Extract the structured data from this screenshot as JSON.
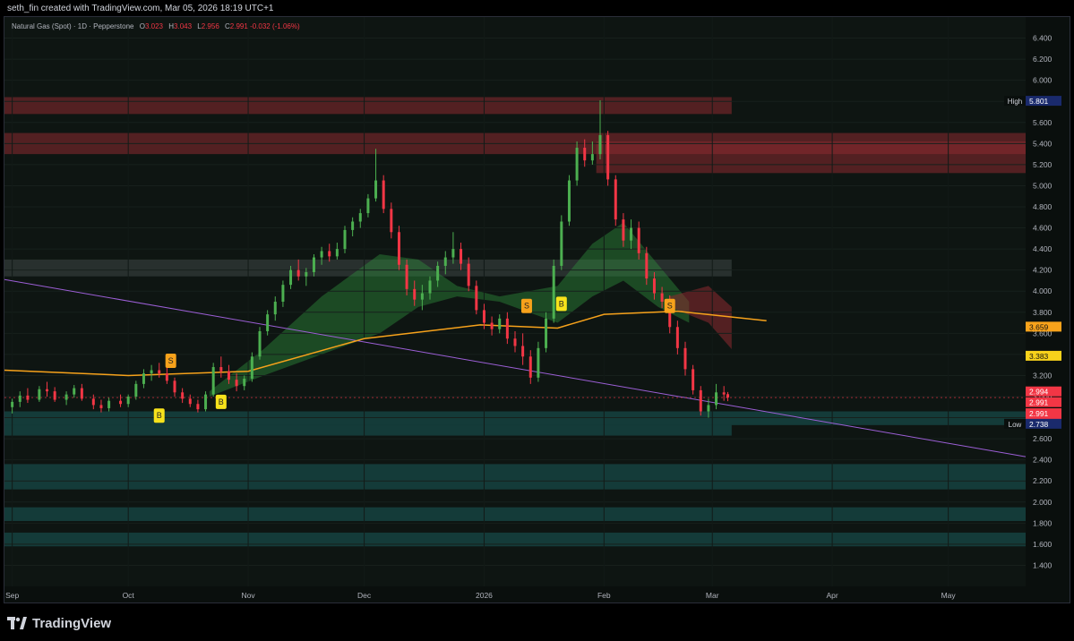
{
  "header": {
    "created_by": "seth_fin created with TradingView.com, Mar 05, 2026 18:19 UTC+1"
  },
  "brand": {
    "name": "TradingView"
  },
  "legend": {
    "symbol": "Natural Gas (Spot) · 1D · Pepperstone",
    "open_label": "O",
    "open": "3.023",
    "high_label": "H",
    "high": "3.043",
    "low_label": "L",
    "low": "2.956",
    "close_label": "C",
    "close": "2.991",
    "change": "-0.032 (-1.06%)"
  },
  "chart_data": {
    "type": "candlestick",
    "title": "Natural Gas (Spot) · 1D · Pepperstone",
    "ylim": [
      1.2,
      6.6
    ],
    "y_ticks": [
      "6.400",
      "6.200",
      "6.000",
      "5.800",
      "5.600",
      "5.400",
      "5.200",
      "5.000",
      "4.800",
      "4.600",
      "4.400",
      "4.200",
      "4.000",
      "3.800",
      "3.600",
      "3.400",
      "3.200",
      "3.000",
      "2.800",
      "2.600",
      "2.400",
      "2.200",
      "2.000",
      "1.800",
      "1.600",
      "1.400"
    ],
    "x_ticks": [
      {
        "label": "Sep",
        "date": "2025-09-01"
      },
      {
        "label": "Oct",
        "date": "2025-10-01"
      },
      {
        "label": "Nov",
        "date": "2025-11-01"
      },
      {
        "label": "Dec",
        "date": "2025-12-01"
      },
      {
        "label": "2026",
        "date": "2026-01-01"
      },
      {
        "label": "Feb",
        "date": "2026-02-01"
      },
      {
        "label": "Mar",
        "date": "2026-03-01"
      },
      {
        "label": "Apr",
        "date": "2026-04-01"
      },
      {
        "label": "May",
        "date": "2026-05-01"
      }
    ],
    "x_range": [
      "2025-08-30",
      "2026-05-21"
    ],
    "colors": {
      "up": "#4caf50",
      "down": "#f23645",
      "ma": "#f7a21b",
      "trendline": "#9c5fd6",
      "cloud": "#1e6b36",
      "supply": "#8c2a2f",
      "demand": "#1c6b6a"
    },
    "price_labels": [
      {
        "name": "High",
        "value": "5.801",
        "bg": "#1a2a6c"
      },
      {
        "name": "",
        "value": "3.659",
        "bg": "#f7a21b"
      },
      {
        "name": "",
        "value": "3.383",
        "bg": "#f7d21b"
      },
      {
        "name": "",
        "value": "2.994",
        "bg": "#f23645"
      },
      {
        "name": "",
        "value": "2.991",
        "bg": "#f23645"
      },
      {
        "name": "",
        "value": "2.991",
        "countdown": "04:39:30",
        "bg": "#f23645"
      },
      {
        "name": "Low",
        "value": "2.738",
        "bg": "#1a2a6c"
      }
    ],
    "moving_average": [
      {
        "date": "2025-08-30",
        "value": 3.25
      },
      {
        "date": "2025-10-01",
        "value": 3.2
      },
      {
        "date": "2025-11-01",
        "value": 3.24
      },
      {
        "date": "2025-12-01",
        "value": 3.55
      },
      {
        "date": "2025-12-31",
        "value": 3.68
      },
      {
        "date": "2026-01-20",
        "value": 3.65
      },
      {
        "date": "2026-02-01",
        "value": 3.78
      },
      {
        "date": "2026-02-20",
        "value": 3.81
      },
      {
        "date": "2026-03-15",
        "value": 3.72
      }
    ],
    "trendline": [
      {
        "date": "2025-08-30",
        "value": 4.11
      },
      {
        "date": "2026-05-21",
        "value": 2.43
      }
    ],
    "zones": [
      {
        "kind": "supply",
        "from": "2025-08-30",
        "to": "2026-03-06",
        "low": 5.68,
        "high": 5.84
      },
      {
        "kind": "supply",
        "from": "2025-08-30",
        "to": "2026-05-21",
        "low": 5.3,
        "high": 5.5
      },
      {
        "kind": "supply",
        "from": "2026-01-30",
        "to": "2026-05-21",
        "low": 5.12,
        "high": 5.42
      },
      {
        "kind": "neutral",
        "from": "2025-08-30",
        "to": "2026-03-06",
        "low": 4.14,
        "high": 4.3
      },
      {
        "kind": "demand",
        "from": "2025-08-30",
        "to": "2026-05-21",
        "low": 2.73,
        "high": 2.86
      },
      {
        "kind": "demand",
        "from": "2025-08-30",
        "to": "2026-03-06",
        "low": 2.63,
        "high": 2.73
      },
      {
        "kind": "demand",
        "from": "2025-08-30",
        "to": "2026-05-21",
        "low": 2.12,
        "high": 2.36
      },
      {
        "kind": "demand",
        "from": "2025-08-30",
        "to": "2026-05-21",
        "low": 1.82,
        "high": 1.95
      },
      {
        "kind": "demand",
        "from": "2025-08-30",
        "to": "2026-05-21",
        "low": 1.58,
        "high": 1.71
      }
    ],
    "signals": [
      {
        "label": "S",
        "date": "2025-10-12",
        "value": 3.34,
        "color": "#f7a21b"
      },
      {
        "label": "B",
        "date": "2025-10-09",
        "value": 2.82,
        "color": "#f7e21b"
      },
      {
        "label": "B",
        "date": "2025-10-25",
        "value": 2.95,
        "color": "#f7e21b"
      },
      {
        "label": "S",
        "date": "2026-01-12",
        "value": 3.86,
        "color": "#f7a21b"
      },
      {
        "label": "B",
        "date": "2026-01-21",
        "value": 3.88,
        "color": "#f7e21b"
      },
      {
        "label": "S",
        "date": "2026-02-18",
        "value": 3.86,
        "color": "#f7a21b"
      }
    ],
    "candles": [
      {
        "d": "2025-09-01",
        "o": 2.9,
        "h": 2.98,
        "l": 2.84,
        "c": 2.95
      },
      {
        "d": "2025-09-03",
        "o": 2.95,
        "h": 3.05,
        "l": 2.9,
        "c": 3.01
      },
      {
        "d": "2025-09-05",
        "o": 3.01,
        "h": 3.08,
        "l": 2.94,
        "c": 2.97
      },
      {
        "d": "2025-09-08",
        "o": 2.97,
        "h": 3.1,
        "l": 2.95,
        "c": 3.07
      },
      {
        "d": "2025-09-10",
        "o": 3.07,
        "h": 3.14,
        "l": 3.0,
        "c": 3.05
      },
      {
        "d": "2025-09-12",
        "o": 3.05,
        "h": 3.09,
        "l": 2.95,
        "c": 2.97
      },
      {
        "d": "2025-09-15",
        "o": 2.97,
        "h": 3.05,
        "l": 2.92,
        "c": 3.02
      },
      {
        "d": "2025-09-17",
        "o": 3.02,
        "h": 3.11,
        "l": 2.99,
        "c": 3.08
      },
      {
        "d": "2025-09-19",
        "o": 3.08,
        "h": 3.12,
        "l": 2.96,
        "c": 2.98
      },
      {
        "d": "2025-09-22",
        "o": 2.98,
        "h": 3.02,
        "l": 2.88,
        "c": 2.92
      },
      {
        "d": "2025-09-24",
        "o": 2.92,
        "h": 2.97,
        "l": 2.85,
        "c": 2.89
      },
      {
        "d": "2025-09-26",
        "o": 2.89,
        "h": 2.99,
        "l": 2.86,
        "c": 2.96
      },
      {
        "d": "2025-09-29",
        "o": 2.96,
        "h": 3.02,
        "l": 2.9,
        "c": 2.93
      },
      {
        "d": "2025-10-01",
        "o": 2.93,
        "h": 3.02,
        "l": 2.9,
        "c": 3.0
      },
      {
        "d": "2025-10-03",
        "o": 3.0,
        "h": 3.15,
        "l": 2.97,
        "c": 3.12
      },
      {
        "d": "2025-10-05",
        "o": 3.12,
        "h": 3.26,
        "l": 3.08,
        "c": 3.22
      },
      {
        "d": "2025-10-07",
        "o": 3.22,
        "h": 3.3,
        "l": 3.15,
        "c": 3.25
      },
      {
        "d": "2025-10-09",
        "o": 3.25,
        "h": 3.32,
        "l": 3.18,
        "c": 3.22
      },
      {
        "d": "2025-10-11",
        "o": 3.22,
        "h": 3.3,
        "l": 3.12,
        "c": 3.15
      },
      {
        "d": "2025-10-13",
        "o": 3.15,
        "h": 3.18,
        "l": 3.0,
        "c": 3.04
      },
      {
        "d": "2025-10-15",
        "o": 3.04,
        "h": 3.08,
        "l": 2.94,
        "c": 2.98
      },
      {
        "d": "2025-10-17",
        "o": 2.98,
        "h": 3.02,
        "l": 2.9,
        "c": 2.93
      },
      {
        "d": "2025-10-19",
        "o": 2.93,
        "h": 2.97,
        "l": 2.85,
        "c": 2.88
      },
      {
        "d": "2025-10-21",
        "o": 2.88,
        "h": 3.05,
        "l": 2.86,
        "c": 3.02
      },
      {
        "d": "2025-10-23",
        "o": 3.02,
        "h": 3.32,
        "l": 3.0,
        "c": 3.28
      },
      {
        "d": "2025-10-25",
        "o": 3.28,
        "h": 3.38,
        "l": 3.18,
        "c": 3.24
      },
      {
        "d": "2025-10-27",
        "o": 3.24,
        "h": 3.3,
        "l": 3.12,
        "c": 3.16
      },
      {
        "d": "2025-10-29",
        "o": 3.16,
        "h": 3.22,
        "l": 3.05,
        "c": 3.1
      },
      {
        "d": "2025-10-31",
        "o": 3.1,
        "h": 3.2,
        "l": 3.06,
        "c": 3.17
      },
      {
        "d": "2025-11-02",
        "o": 3.17,
        "h": 3.42,
        "l": 3.14,
        "c": 3.38
      },
      {
        "d": "2025-11-04",
        "o": 3.38,
        "h": 3.66,
        "l": 3.35,
        "c": 3.62
      },
      {
        "d": "2025-11-06",
        "o": 3.62,
        "h": 3.82,
        "l": 3.58,
        "c": 3.78
      },
      {
        "d": "2025-11-08",
        "o": 3.78,
        "h": 3.95,
        "l": 3.72,
        "c": 3.9
      },
      {
        "d": "2025-11-10",
        "o": 3.9,
        "h": 4.1,
        "l": 3.85,
        "c": 4.06
      },
      {
        "d": "2025-11-12",
        "o": 4.06,
        "h": 4.24,
        "l": 4.02,
        "c": 4.2
      },
      {
        "d": "2025-11-14",
        "o": 4.2,
        "h": 4.3,
        "l": 4.1,
        "c": 4.14
      },
      {
        "d": "2025-11-16",
        "o": 4.14,
        "h": 4.22,
        "l": 4.05,
        "c": 4.18
      },
      {
        "d": "2025-11-18",
        "o": 4.18,
        "h": 4.35,
        "l": 4.14,
        "c": 4.32
      },
      {
        "d": "2025-11-20",
        "o": 4.32,
        "h": 4.42,
        "l": 4.25,
        "c": 4.38
      },
      {
        "d": "2025-11-22",
        "o": 4.38,
        "h": 4.45,
        "l": 4.28,
        "c": 4.33
      },
      {
        "d": "2025-11-24",
        "o": 4.33,
        "h": 4.46,
        "l": 4.3,
        "c": 4.4
      },
      {
        "d": "2025-11-26",
        "o": 4.4,
        "h": 4.62,
        "l": 4.36,
        "c": 4.58
      },
      {
        "d": "2025-11-28",
        "o": 4.58,
        "h": 4.7,
        "l": 4.52,
        "c": 4.66
      },
      {
        "d": "2025-11-30",
        "o": 4.66,
        "h": 4.78,
        "l": 4.6,
        "c": 4.74
      },
      {
        "d": "2025-12-02",
        "o": 4.74,
        "h": 4.92,
        "l": 4.7,
        "c": 4.88
      },
      {
        "d": "2025-12-04",
        "o": 4.88,
        "h": 5.35,
        "l": 4.85,
        "c": 5.05
      },
      {
        "d": "2025-12-06",
        "o": 5.05,
        "h": 5.1,
        "l": 4.74,
        "c": 4.78
      },
      {
        "d": "2025-12-08",
        "o": 4.78,
        "h": 4.84,
        "l": 4.5,
        "c": 4.56
      },
      {
        "d": "2025-12-10",
        "o": 4.56,
        "h": 4.62,
        "l": 4.2,
        "c": 4.25
      },
      {
        "d": "2025-12-12",
        "o": 4.25,
        "h": 4.3,
        "l": 3.96,
        "c": 4.02
      },
      {
        "d": "2025-12-14",
        "o": 4.02,
        "h": 4.1,
        "l": 3.86,
        "c": 3.92
      },
      {
        "d": "2025-12-16",
        "o": 3.92,
        "h": 4.06,
        "l": 3.82,
        "c": 3.98
      },
      {
        "d": "2025-12-18",
        "o": 3.98,
        "h": 4.14,
        "l": 3.92,
        "c": 4.1
      },
      {
        "d": "2025-12-20",
        "o": 4.1,
        "h": 4.28,
        "l": 4.04,
        "c": 4.24
      },
      {
        "d": "2025-12-22",
        "o": 4.24,
        "h": 4.38,
        "l": 4.16,
        "c": 4.32
      },
      {
        "d": "2025-12-24",
        "o": 4.32,
        "h": 4.56,
        "l": 4.26,
        "c": 4.4
      },
      {
        "d": "2025-12-26",
        "o": 4.4,
        "h": 4.46,
        "l": 4.2,
        "c": 4.26
      },
      {
        "d": "2025-12-28",
        "o": 4.26,
        "h": 4.32,
        "l": 4.0,
        "c": 4.05
      },
      {
        "d": "2025-12-30",
        "o": 4.05,
        "h": 4.1,
        "l": 3.78,
        "c": 3.82
      },
      {
        "d": "2026-01-01",
        "o": 3.82,
        "h": 3.88,
        "l": 3.64,
        "c": 3.7
      },
      {
        "d": "2026-01-03",
        "o": 3.7,
        "h": 3.76,
        "l": 3.58,
        "c": 3.64
      },
      {
        "d": "2026-01-05",
        "o": 3.64,
        "h": 3.78,
        "l": 3.6,
        "c": 3.74
      },
      {
        "d": "2026-01-07",
        "o": 3.74,
        "h": 3.8,
        "l": 3.5,
        "c": 3.55
      },
      {
        "d": "2026-01-09",
        "o": 3.55,
        "h": 3.62,
        "l": 3.42,
        "c": 3.48
      },
      {
        "d": "2026-01-11",
        "o": 3.48,
        "h": 3.6,
        "l": 3.3,
        "c": 3.38
      },
      {
        "d": "2026-01-13",
        "o": 3.38,
        "h": 3.44,
        "l": 3.12,
        "c": 3.18
      },
      {
        "d": "2026-01-15",
        "o": 3.18,
        "h": 3.52,
        "l": 3.14,
        "c": 3.46
      },
      {
        "d": "2026-01-17",
        "o": 3.46,
        "h": 3.8,
        "l": 3.42,
        "c": 3.74
      },
      {
        "d": "2026-01-19",
        "o": 3.74,
        "h": 4.3,
        "l": 3.7,
        "c": 4.24
      },
      {
        "d": "2026-01-21",
        "o": 4.24,
        "h": 4.72,
        "l": 4.2,
        "c": 4.66
      },
      {
        "d": "2026-01-23",
        "o": 4.66,
        "h": 5.1,
        "l": 4.62,
        "c": 5.05
      },
      {
        "d": "2026-01-25",
        "o": 5.05,
        "h": 5.42,
        "l": 5.0,
        "c": 5.36
      },
      {
        "d": "2026-01-27",
        "o": 5.36,
        "h": 5.44,
        "l": 5.18,
        "c": 5.24
      },
      {
        "d": "2026-01-29",
        "o": 5.24,
        "h": 5.42,
        "l": 5.2,
        "c": 5.3
      },
      {
        "d": "2026-01-31",
        "o": 5.3,
        "h": 5.81,
        "l": 5.25,
        "c": 5.48
      },
      {
        "d": "2026-02-02",
        "o": 5.48,
        "h": 5.52,
        "l": 5.0,
        "c": 5.06
      },
      {
        "d": "2026-02-04",
        "o": 5.06,
        "h": 5.1,
        "l": 4.62,
        "c": 4.68
      },
      {
        "d": "2026-02-06",
        "o": 4.68,
        "h": 4.74,
        "l": 4.42,
        "c": 4.48
      },
      {
        "d": "2026-02-08",
        "o": 4.48,
        "h": 4.68,
        "l": 4.4,
        "c": 4.6
      },
      {
        "d": "2026-02-10",
        "o": 4.6,
        "h": 4.66,
        "l": 4.3,
        "c": 4.36
      },
      {
        "d": "2026-02-12",
        "o": 4.36,
        "h": 4.42,
        "l": 4.06,
        "c": 4.12
      },
      {
        "d": "2026-02-14",
        "o": 4.12,
        "h": 4.18,
        "l": 3.92,
        "c": 3.98
      },
      {
        "d": "2026-02-16",
        "o": 3.98,
        "h": 4.04,
        "l": 3.84,
        "c": 3.9
      },
      {
        "d": "2026-02-18",
        "o": 3.9,
        "h": 3.96,
        "l": 3.6,
        "c": 3.66
      },
      {
        "d": "2026-02-20",
        "o": 3.66,
        "h": 3.72,
        "l": 3.4,
        "c": 3.46
      },
      {
        "d": "2026-02-22",
        "o": 3.46,
        "h": 3.52,
        "l": 3.2,
        "c": 3.26
      },
      {
        "d": "2026-02-24",
        "o": 3.26,
        "h": 3.3,
        "l": 3.02,
        "c": 3.06
      },
      {
        "d": "2026-02-26",
        "o": 3.06,
        "h": 3.1,
        "l": 2.82,
        "c": 2.86
      },
      {
        "d": "2026-02-28",
        "o": 2.86,
        "h": 2.98,
        "l": 2.8,
        "c": 2.92
      },
      {
        "d": "2026-03-02",
        "o": 2.92,
        "h": 3.12,
        "l": 2.88,
        "c": 3.04
      },
      {
        "d": "2026-03-04",
        "o": 3.04,
        "h": 3.1,
        "l": 2.96,
        "c": 3.02
      },
      {
        "d": "2026-03-05",
        "o": 3.023,
        "h": 3.043,
        "l": 2.956,
        "c": 2.991
      }
    ]
  }
}
